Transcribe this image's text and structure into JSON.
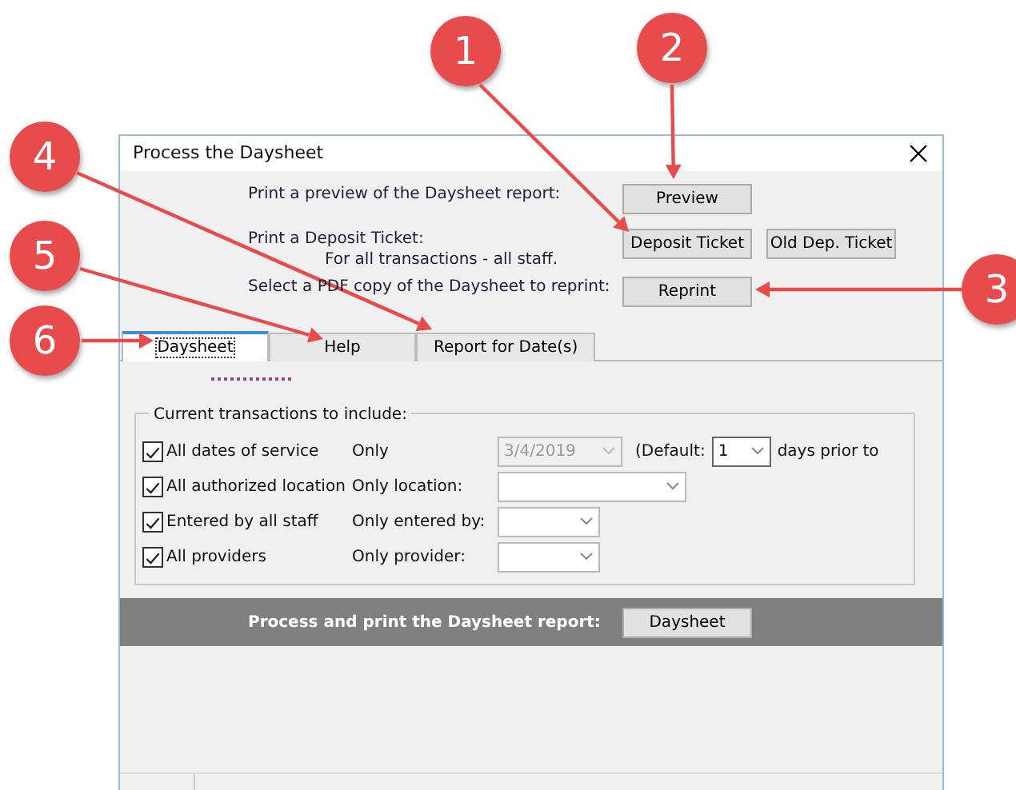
{
  "window": {
    "title": "Process the Daysheet"
  },
  "actions": [
    {
      "label": "Print a preview of the Daysheet report:",
      "buttons": [
        "Preview"
      ]
    },
    {
      "label": "Print a Deposit Ticket:",
      "sublabel": "For all transactions - all staff.",
      "buttons": [
        "Deposit Ticket",
        "Old Dep. Ticket"
      ]
    },
    {
      "label": "Select a PDF copy of the Daysheet to reprint:",
      "buttons": [
        "Reprint"
      ]
    }
  ],
  "tabs": [
    {
      "label": "Daysheet",
      "selected": true
    },
    {
      "label": "Help",
      "selected": false
    },
    {
      "label": "Report for Date(s)",
      "selected": false
    }
  ],
  "group": {
    "title": "Current transactions to include:",
    "rows": [
      {
        "label": "All dates of service",
        "checked": true,
        "filter_label": "Only",
        "value": "3/4/2019",
        "disabled": true,
        "default_label": "(Default:",
        "default_value": "1",
        "default_suffix": "days prior to"
      },
      {
        "label": "All authorized location",
        "checked": true,
        "filter_label": "Only location:",
        "value": "",
        "disabled": false
      },
      {
        "label": "Entered by all staff",
        "checked": true,
        "filter_label": "Only entered by:",
        "value": "",
        "disabled": false
      },
      {
        "label": "All providers",
        "checked": true,
        "filter_label": "Only provider:",
        "value": "",
        "disabled": false
      }
    ]
  },
  "process_bar": {
    "label": "Process and print the Daysheet report:",
    "button": "Daysheet"
  },
  "callouts": [
    {
      "label": "1"
    },
    {
      "label": "2"
    },
    {
      "label": "3"
    },
    {
      "label": "4"
    },
    {
      "label": "5"
    },
    {
      "label": "6"
    }
  ]
}
